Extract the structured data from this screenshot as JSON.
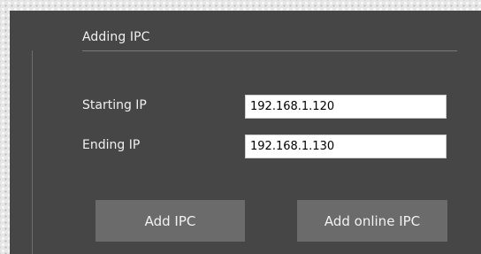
{
  "section": {
    "title": "Adding IPC"
  },
  "starting_ip": {
    "label": "Starting IP",
    "value": "192.168.1.120"
  },
  "ending_ip": {
    "label": "Ending IP",
    "value": "192.168.1.130"
  },
  "buttons": {
    "add_ipc": "Add IPC",
    "add_online_ipc": "Add online IPC"
  }
}
